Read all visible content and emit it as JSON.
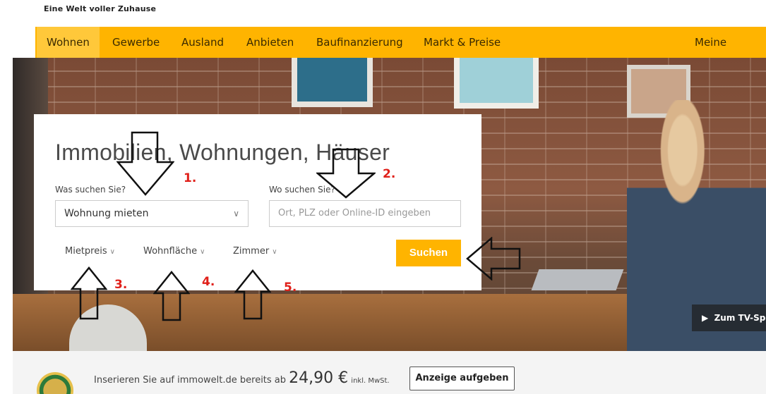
{
  "header": {
    "tagline": "Eine Welt voller Zuhause"
  },
  "nav": {
    "items": [
      {
        "label": "Wohnen"
      },
      {
        "label": "Gewerbe"
      },
      {
        "label": "Ausland"
      },
      {
        "label": "Anbieten"
      },
      {
        "label": "Baufinanzierung"
      },
      {
        "label": "Markt & Preise"
      },
      {
        "label": "Meine Immow"
      }
    ],
    "active": "Wohnen",
    "bg_color": "#ffb400"
  },
  "search": {
    "headline": "Immobilien, Wohnungen, Häuser",
    "what_label": "Was suchen Sie?",
    "what_value": "Wohnung mieten",
    "where_label": "Wo suchen Sie?",
    "where_placeholder": "Ort, PLZ oder Online-ID eingeben",
    "filters": [
      "Mietpreis",
      "Wohnfläche",
      "Zimmer"
    ],
    "submit_label": "Suchen",
    "accent_color": "#ffb400"
  },
  "annotations": [
    "1.",
    "2.",
    "3.",
    "4.",
    "5."
  ],
  "tv": {
    "label": "Zum TV-Sp"
  },
  "promo": {
    "text": "Inserieren Sie auf immowelt.de bereits ab",
    "price": "24,90 €",
    "tax_note": "inkl. MwSt.",
    "button_label": "Anzeige aufgeben"
  },
  "icons": [
    "chevron-down-icon",
    "play-icon",
    "arrow-down-icon",
    "arrow-up-icon",
    "arrow-left-icon",
    "award-badge-icon"
  ]
}
